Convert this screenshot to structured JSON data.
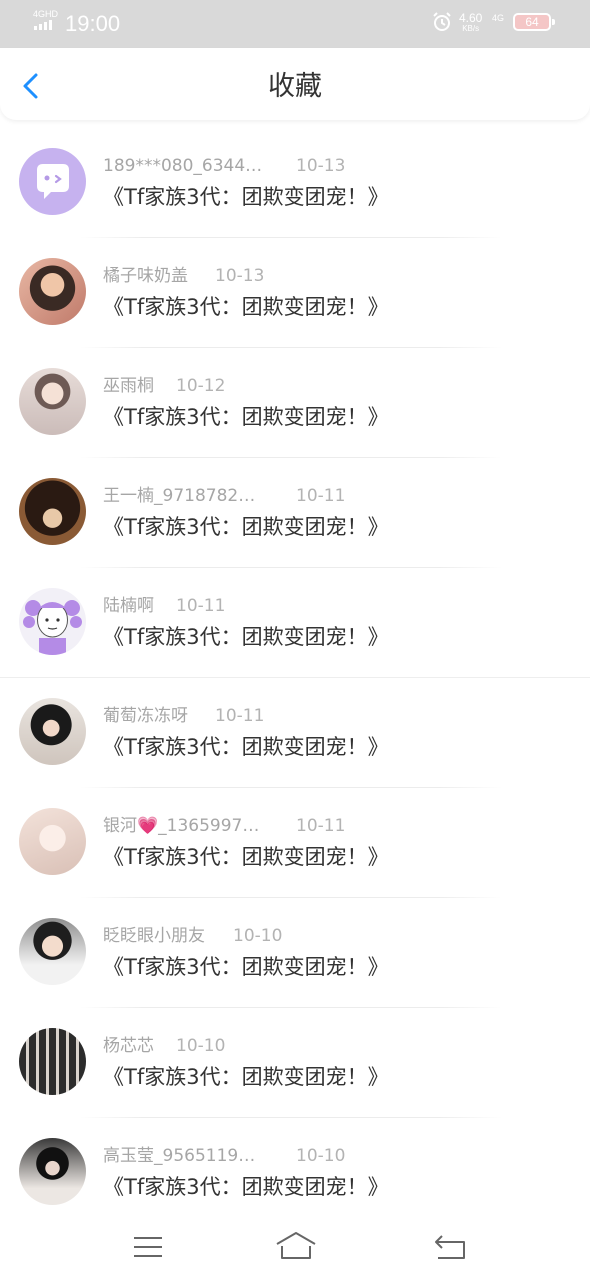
{
  "status_bar": {
    "network": "4GHD",
    "time": "19:00",
    "speed_value": "4.60",
    "speed_unit": "KB/s",
    "network2": "4G",
    "battery": "64",
    "icons": [
      "signal-icon",
      "alarm-icon",
      "battery-icon"
    ]
  },
  "header": {
    "back_icon": "chevron-left-icon",
    "title": "收藏",
    "accent_color": "#1e90ff"
  },
  "favorites": [
    {
      "name": "189***080_6344…",
      "date": "10-13",
      "title": "《Tf家族3代：团欺变团宠！》",
      "avatar": "purple-chat-bubble"
    },
    {
      "name": "橘子味奶盖",
      "date": "10-13",
      "title": "《Tf家族3代：团欺变团宠！》",
      "avatar": "photo"
    },
    {
      "name": "巫雨桐",
      "date": "10-12",
      "title": "《Tf家族3代：团欺变团宠！》",
      "avatar": "photo"
    },
    {
      "name": "王一楠_9718782…",
      "date": "10-11",
      "title": "《Tf家族3代：团欺变团宠！》",
      "avatar": "dog-photo"
    },
    {
      "name": "陆楠啊",
      "date": "10-11",
      "title": "《Tf家族3代：团欺变团宠！》",
      "avatar": "cartoon"
    },
    {
      "name": "葡萄冻冻呀",
      "date": "10-11",
      "title": "《Tf家族3代：团欺变团宠！》",
      "avatar": "photo"
    },
    {
      "name": "银河💗_1365997…",
      "date": "10-11",
      "title": "《Tf家族3代：团欺变团宠！》",
      "avatar": "anime"
    },
    {
      "name": "眨眨眼小朋友",
      "date": "10-10",
      "title": "《Tf家族3代：团欺变团宠！》",
      "avatar": "photo"
    },
    {
      "name": "杨芯芯",
      "date": "10-10",
      "title": "《Tf家族3代：团欺变团宠！》",
      "avatar": "group-photo"
    },
    {
      "name": "高玉莹_9565119…",
      "date": "10-10",
      "title": "《Tf家族3代：团欺变团宠！》",
      "avatar": "photo"
    }
  ],
  "nav_bar": {
    "icons": [
      "menu-icon",
      "home-icon",
      "back-icon"
    ]
  }
}
